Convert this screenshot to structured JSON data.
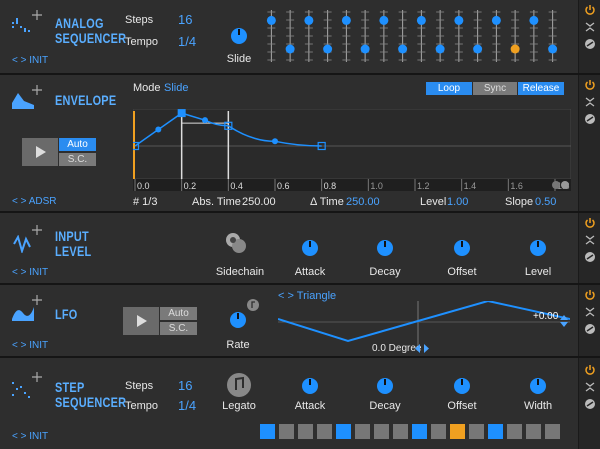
{
  "colors": {
    "accent": "#1e90ff",
    "highlight": "#f0a020",
    "panel": "#2e2e2e",
    "rail": "#262626"
  },
  "analog_sequencer": {
    "title_line1": "ANALOG",
    "title_line2": "SEQUENCER",
    "preset": "INIT",
    "steps_label": "Steps",
    "steps_value": "16",
    "tempo_label": "Tempo",
    "tempo_value": "1/4",
    "slide_label": "Slide",
    "slider_levels": [
      0.8,
      0.25,
      0.8,
      0.25,
      0.8,
      0.25,
      0.8,
      0.25,
      0.8,
      0.25,
      0.8,
      0.25,
      0.8,
      0.25,
      0.8,
      0.25
    ],
    "active_step": 13
  },
  "envelope": {
    "title": "ENVELOPE",
    "preset": "ADSR",
    "mode_label": "Mode",
    "mode_value": "Slide",
    "loop_label": "Loop",
    "sync_label": "Sync",
    "release_label": "Release",
    "auto_label": "Auto",
    "sc_label": "S.C.",
    "ticks": [
      "0.0",
      "0.2",
      "0.4",
      "0.6",
      "0.8",
      "1.0",
      "1.2",
      "1.4",
      "1.6",
      "1.8"
    ],
    "points": [
      [
        0.0,
        0.0
      ],
      [
        0.1,
        0.35
      ],
      [
        0.2,
        0.7
      ],
      [
        0.3,
        0.55
      ],
      [
        0.4,
        0.43
      ],
      [
        0.6,
        0.1
      ],
      [
        0.8,
        0.0
      ]
    ],
    "point_label": "# 1/3",
    "abs_time_label": "Abs. Time",
    "abs_time_value": "250.00",
    "delta_time_label": "Δ Time",
    "delta_time_value": "250.00",
    "level_label": "Level",
    "level_value": "1.00",
    "slope_label": "Slope",
    "slope_value": "0.50"
  },
  "input_level": {
    "title_line1": "INPUT",
    "title_line2": "LEVEL",
    "preset": "INIT",
    "knobs": [
      "Sidechain",
      "Attack",
      "Decay",
      "Offset",
      "Level"
    ]
  },
  "lfo": {
    "title": "LFO",
    "preset": "INIT",
    "auto_label": "Auto",
    "sc_label": "S.C.",
    "rate_label": "Rate",
    "waveform": "Triangle",
    "phase": "0.0 Degree",
    "offset_value": "+0.00"
  },
  "step_sequencer": {
    "title_line1": "STEP",
    "title_line2": "SEQUENCER",
    "preset": "INIT",
    "steps_label": "Steps",
    "steps_value": "16",
    "tempo_label": "Tempo",
    "tempo_value": "1/4",
    "knobs": [
      "Legato",
      "Attack",
      "Decay",
      "Offset",
      "Width"
    ],
    "steps": [
      "on",
      "off",
      "off",
      "off",
      "on",
      "off",
      "off",
      "off",
      "on",
      "off",
      "highlight",
      "off",
      "on",
      "off",
      "off",
      "off"
    ]
  }
}
